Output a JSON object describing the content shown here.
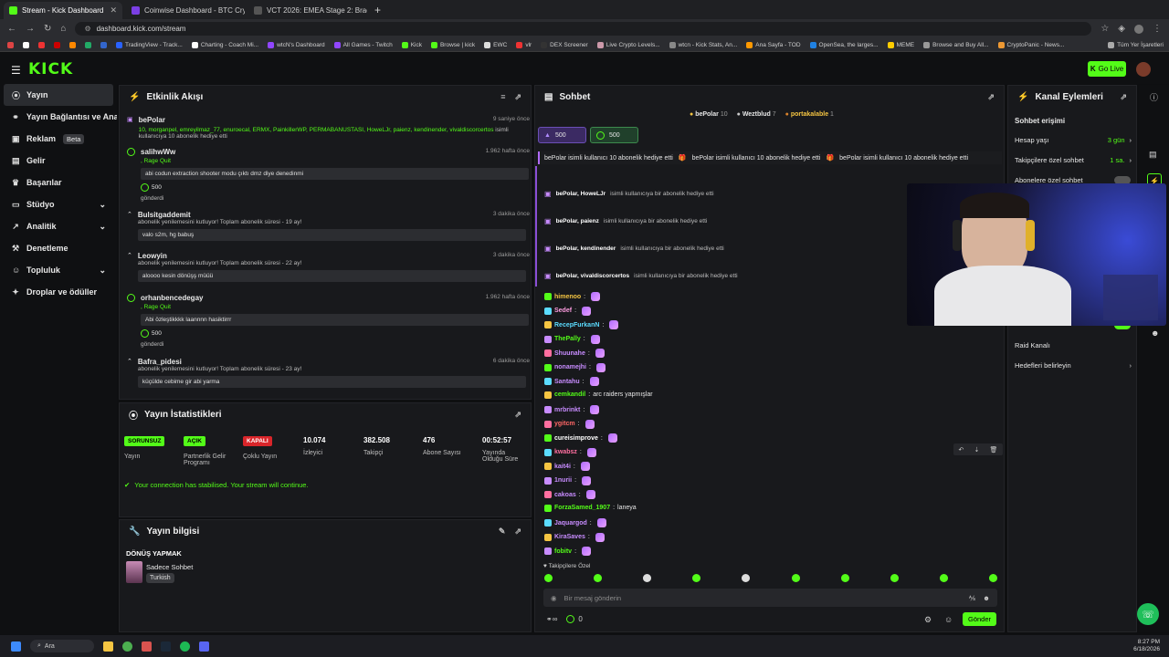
{
  "browser": {
    "tabs": [
      {
        "title": "Stream - Kick Dashboard",
        "color": "#53fc18",
        "active": true
      },
      {
        "title": "Coinwise Dashboard - BTC Cryp",
        "color": "#7b3fe4",
        "active": false
      },
      {
        "title": "VCT 2026: EMEA Stage 2: Brack",
        "color": "#444",
        "active": false
      }
    ],
    "url": "dashboard.kick.com/stream",
    "bookmarks": [
      "TradingView - Track...",
      "Charting - Coach Mi...",
      "wtcN's Dashboard",
      "All Games - Twitch",
      "Kick",
      "Browse | kick",
      "EWC",
      "vlr",
      "DEX Screener",
      "Live Crypto Levels...",
      "wtcn - Kick Stats, An...",
      "Ana Sayfa - TOD",
      "OpenSea, the larges...",
      "MEME",
      "Browse and Buy All...",
      "CryptoPanic - News..."
    ],
    "bookmarks_all": "Tüm Yer İşaretleri"
  },
  "app": {
    "logo": "KICK",
    "go_live": "Go Live"
  },
  "sidebar": {
    "items": [
      {
        "label": "Yayın",
        "icon": "((·))"
      },
      {
        "label": "Yayın Bağlantısı ve Anahtarı",
        "icon": "🔗"
      },
      {
        "label": "Reklam",
        "icon": "▣",
        "badge": "Beta"
      },
      {
        "label": "Gelir",
        "icon": "▤"
      },
      {
        "label": "Başarılar",
        "icon": "🏆"
      },
      {
        "label": "Stüdyo",
        "icon": "▭"
      },
      {
        "label": "Analitik",
        "icon": "↗"
      },
      {
        "label": "Denetleme",
        "icon": "🔨"
      },
      {
        "label": "Topluluk",
        "icon": "👥"
      },
      {
        "label": "Droplar ve ödüller",
        "icon": "🎁"
      }
    ]
  },
  "activity": {
    "title": "Etkinlik Akışı",
    "items": [
      {
        "name": "bePolar",
        "time": "9 saniye önce",
        "highlight": "10, morganpel, emreyilmaz_77, enuroecal, ERMX, PainkillerWP, PERMABANUSTASI, HoweLJr, paienz, kendinender, vivaldiscorcertos",
        "sub": "isimli kullanıcıya 10 abonelik hediye etti"
      },
      {
        "name": "salihwWw",
        "time": "1.962 hafta önce",
        "tag": ", Rage Quit",
        "message": "abi codun extraction shooter modu çıktı dmz diye denedinmi",
        "amount": "500",
        "footer": "gönderdi"
      },
      {
        "name": "Bulsitgaddemit",
        "time": "3 dakika önce",
        "sub": "abonelik yenilemesini kutluyor! Toplam abonelik süresi - 19 ay!",
        "message": "valo s2m, hg babuş"
      },
      {
        "name": "Leowyin",
        "time": "3 dakika önce",
        "sub": "abonelik yenilemesini kutluyor! Toplam abonelik süresi - 22 ay!",
        "message": "aloooo kesin dönüşş müüü"
      },
      {
        "name": "orhanbencedegay",
        "time": "1.962 hafta önce",
        "tag": ", Rage Quit",
        "message": "Abi özleştikkkk laannnn hasiktirrr",
        "amount": "500",
        "footer": "gönderdi"
      },
      {
        "name": "Bafra_pidesi",
        "time": "6 dakika önce",
        "sub": "abonelik yenilemesini kutluyor! Toplam abonelik süresi - 23 ay!",
        "message": "küçülde cebime gir abi yarma"
      }
    ]
  },
  "stats": {
    "title": "Yayın İstatistikleri",
    "cols": [
      {
        "tag": "SORUNSUZ",
        "label": "Yayın",
        "tag_color": "#53fc18"
      },
      {
        "tag": "AÇIK",
        "label": "Partnerlik Gelir Programı",
        "tag_color": "#53fc18"
      },
      {
        "tag": "KAPALI",
        "label": "Çoklu Yayın",
        "tag_color": "#d9252a"
      },
      {
        "value": "10.074",
        "label": "İzleyici"
      },
      {
        "value": "382.508",
        "label": "Takipçi"
      },
      {
        "value": "476",
        "label": "Abone Sayısı"
      },
      {
        "value": "00:52:57",
        "label": "Yayında Olduğu Süre"
      }
    ],
    "notice": "Your connection has stabilised. Your stream will continue."
  },
  "info": {
    "title": "Yayın bilgisi",
    "stream_title": "DÖNÜŞ YAPMAK",
    "category": "Sadece Sohbet",
    "language": "Turkish"
  },
  "chat": {
    "title": "Sohbet",
    "top_gifters": [
      {
        "name": "bePolar",
        "count": "10"
      },
      {
        "name": "Weztblud",
        "count": "7"
      },
      {
        "name": "portakalable",
        "count": "1"
      }
    ],
    "pinned": [
      {
        "value": "500"
      },
      {
        "value": "500"
      }
    ],
    "banner": "bePolar isimli kullanıcı 10 abonelik hediye etti",
    "gifts": [
      {
        "names": "bePolar, HoweLJr",
        "text": "isimli kullanıcıya bir abonelik hediye etti"
      },
      {
        "names": "bePolar, paienz",
        "text": "isimli kullanıcıya bir abonelik hediye etti"
      },
      {
        "names": "bePolar, kendinender",
        "text": "isimli kullanıcıya bir abonelik hediye etti"
      },
      {
        "names": "bePolar, vivaldiscorcertos",
        "text": "isimli kullanıcıya bir abonelik hediye etti"
      }
    ],
    "messages": [
      {
        "user": "himenoo",
        "color": "#f5c542",
        "text": ""
      },
      {
        "user": "Sedef",
        "color": "#ff9de2",
        "text": ""
      },
      {
        "user": "RecepFurkanN",
        "color": "#5bdcff",
        "text": ""
      },
      {
        "user": "ThePally",
        "color": "#53fc18",
        "text": ""
      },
      {
        "user": "Shuunahe",
        "color": "#c88cff",
        "text": ""
      },
      {
        "user": "nonamejhi",
        "color": "#c88cff",
        "text": ""
      },
      {
        "user": "Santahu",
        "color": "#c88cff",
        "text": ""
      },
      {
        "user": "cemkandil",
        "color": "#53fc18",
        "text": "arc raiders yapmışlar"
      },
      {
        "user": "mrbrinkt",
        "color": "#c88cff",
        "text": ""
      },
      {
        "user": "ygitcm",
        "color": "#ff6666",
        "text": ""
      },
      {
        "user": "cureisimprove",
        "color": "#ffffff",
        "text": ""
      },
      {
        "user": "kwabsz",
        "color": "#ff6fa0",
        "text": ""
      },
      {
        "user": "kait4i",
        "color": "#c88cff",
        "text": ""
      },
      {
        "user": "1nurii",
        "color": "#c88cff",
        "text": ""
      },
      {
        "user": "cakoas",
        "color": "#c88cff",
        "text": ""
      },
      {
        "user": "ForzaSamed_1907",
        "color": "#53fc18",
        "text": "laneya"
      },
      {
        "user": "Jaquargod",
        "color": "#c88cff",
        "text": ""
      },
      {
        "user": "KiraSaves",
        "color": "#c88cff",
        "text": ""
      },
      {
        "user": "fobitv",
        "color": "#53fc18",
        "text": ""
      }
    ],
    "followers_only": "Takipçilere Özel",
    "input_placeholder": "Bir mesaj gönderin",
    "points": "0",
    "send": "Gönder"
  },
  "channel": {
    "title": "Kanal Eylemleri",
    "section": "Sohbet erişimi",
    "items": [
      {
        "label": "Hesap yaşı",
        "value": "3 gün"
      },
      {
        "label": "Takipçilere özel sohbet",
        "value": "1 sa."
      },
      {
        "label": "Abonelere özel sohbet",
        "value": ""
      },
      {
        "label": "İfade bazlı sohbet",
        "value": ""
      },
      {
        "label": "Raid Kanalı",
        "value": ""
      },
      {
        "label": "Hedefleri belirleyin",
        "value": ""
      }
    ]
  },
  "taskbar": {
    "search": "Ara",
    "time": "8:27 PM",
    "date": "6/18/2026"
  }
}
